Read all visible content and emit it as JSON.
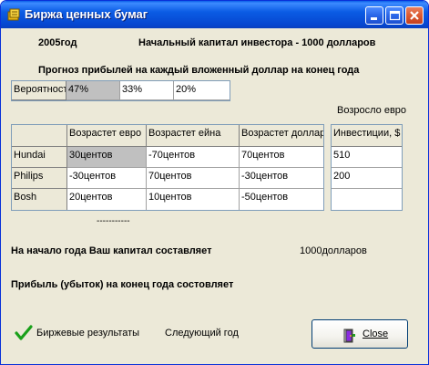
{
  "window": {
    "title": "Биржа ценных бумаг"
  },
  "header": {
    "year": "2005год",
    "capital": "Начальный капитал инвестора - 1000 долларов",
    "forecast": "Прогноз прибылей на каждый вложенный доллар на конец года"
  },
  "prob_table": {
    "row_label": "Вероятность",
    "values": [
      "47%",
      "33%",
      "20%"
    ]
  },
  "invest_caption": "Возросло евро",
  "main_table": {
    "headers": [
      "Возрастет евро",
      "Возрастет ейна",
      "Возрастет доллар"
    ],
    "rows": [
      {
        "name": "Hundai",
        "values": [
          "30центов",
          "-70центов",
          "70центов"
        ]
      },
      {
        "name": "Philips",
        "values": [
          "-30центов",
          "70центов",
          "-30центов"
        ]
      },
      {
        "name": "Bosh",
        "values": [
          "20центов",
          "10центов",
          "-50центов"
        ]
      }
    ]
  },
  "invest_table": {
    "header": "Инвестиции, $",
    "values": [
      "510",
      "200",
      ""
    ]
  },
  "dashes": "-----------",
  "status": {
    "start_capital_label": "На начало года Ваш капитал составляет",
    "start_capital_value": "1000долларов",
    "profit_label": "Прибыль (убыток) на конец года состовляет"
  },
  "buttons": {
    "results": "Биржевые результаты",
    "next_year": "Следующий год",
    "close": "Close"
  },
  "colors": {
    "titlebar": "#0b5ce4",
    "window_bg": "#ece9d8",
    "selected_cell": "#c0c0c0",
    "check_green": "#1aa01a"
  }
}
